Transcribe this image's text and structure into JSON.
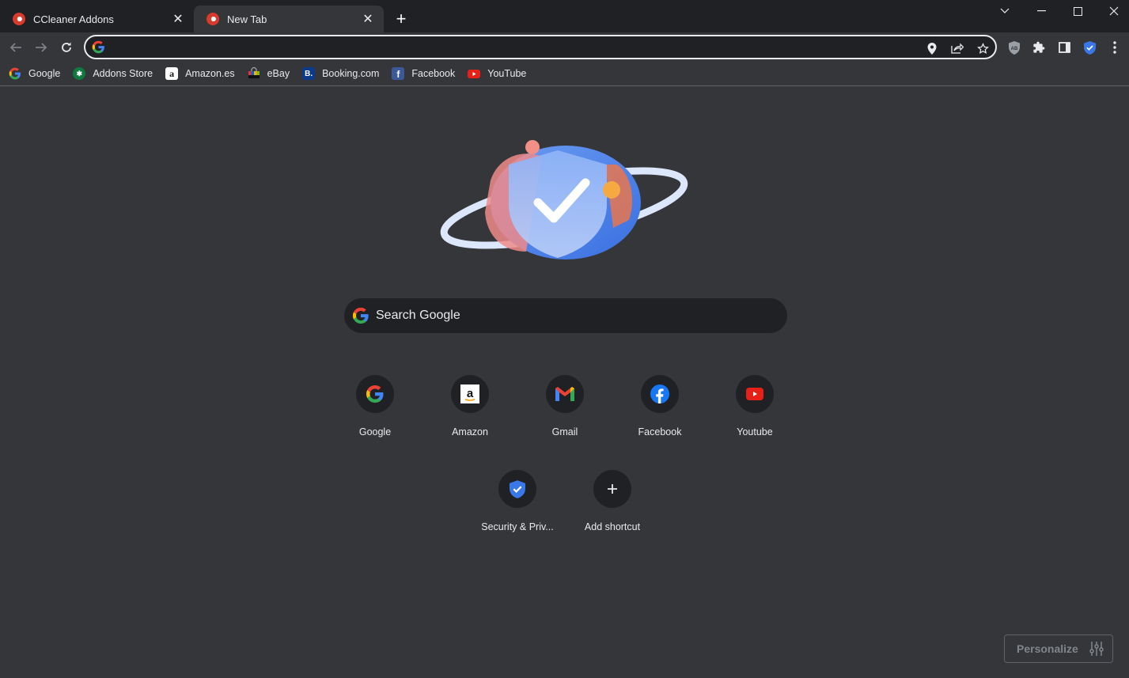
{
  "window": {
    "tabs": [
      {
        "title": "CCleaner Addons",
        "active": false
      },
      {
        "title": "New Tab",
        "active": true
      }
    ],
    "new_tab_label": "+",
    "controls": [
      "tab-search",
      "minimize",
      "maximize",
      "close"
    ]
  },
  "toolbar": {
    "address_value": "",
    "omnibox_icons": [
      "location-icon",
      "share-icon",
      "bookmark-star-icon"
    ],
    "extensions": [
      "adblock-icon",
      "extensions-puzzle-icon",
      "side-panel-icon",
      "security-shield-icon",
      "menu-icon"
    ]
  },
  "bookmarks": [
    {
      "label": "Google",
      "icon": "google-icon"
    },
    {
      "label": "Addons Store",
      "icon": "addons-store-icon"
    },
    {
      "label": "Amazon.es",
      "icon": "amazon-icon"
    },
    {
      "label": "eBay",
      "icon": "ebay-icon"
    },
    {
      "label": "Booking.com",
      "icon": "booking-icon"
    },
    {
      "label": "Facebook",
      "icon": "facebook-icon"
    },
    {
      "label": "YouTube",
      "icon": "youtube-icon"
    }
  ],
  "ntp": {
    "search_placeholder": "Search Google",
    "shortcuts": [
      {
        "label": "Google",
        "icon": "google-icon"
      },
      {
        "label": "Amazon",
        "icon": "amazon-icon"
      },
      {
        "label": "Gmail",
        "icon": "gmail-icon"
      },
      {
        "label": "Facebook",
        "icon": "facebook-icon"
      },
      {
        "label": "Youtube",
        "icon": "youtube-icon"
      },
      {
        "label": "Security & Priv...",
        "icon": "security-shield-icon"
      },
      {
        "label": "Add shortcut",
        "icon": "plus-icon"
      }
    ],
    "personalize_label": "Personalize"
  },
  "colors": {
    "frame": "#202124",
    "toolbar": "#35363a",
    "text": "#e8eaed",
    "accent_blue": "#3b78e7"
  }
}
